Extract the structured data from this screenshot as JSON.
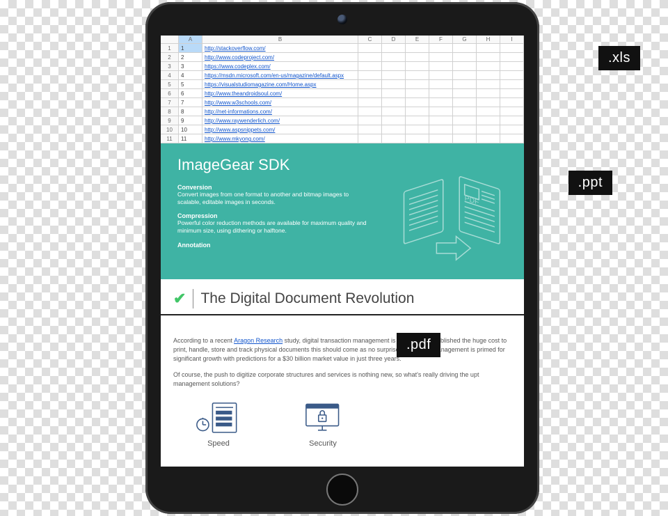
{
  "badges": {
    "xls": ".xls",
    "ppt": ".ppt",
    "pdf": ".pdf"
  },
  "spreadsheet": {
    "columns": [
      "A",
      "B",
      "C",
      "D",
      "E",
      "F",
      "G",
      "H",
      "I"
    ],
    "rows": [
      {
        "n": "1",
        "a": "1",
        "url": "http://stackoverflow.com/"
      },
      {
        "n": "2",
        "a": "2",
        "url": "http://www.codeproject.com/"
      },
      {
        "n": "3",
        "a": "3",
        "url": "https://www.codeplex.com/"
      },
      {
        "n": "4",
        "a": "4",
        "url": "https://msdn.microsoft.com/en-us/magazine/default.aspx"
      },
      {
        "n": "5",
        "a": "5",
        "url": "https://visualstudiomagazine.com/Home.aspx"
      },
      {
        "n": "6",
        "a": "6",
        "url": "http://www.theandroidsoul.com/"
      },
      {
        "n": "7",
        "a": "7",
        "url": "http://www.w3schools.com/"
      },
      {
        "n": "8",
        "a": "8",
        "url": "http://net-informations.com/"
      },
      {
        "n": "9",
        "a": "9",
        "url": "http://www.raywenderlich.com/"
      },
      {
        "n": "10",
        "a": "10",
        "url": "http://www.aspsnippets.com/"
      },
      {
        "n": "11",
        "a": "11",
        "url": "http://www.mkyong.com/"
      }
    ]
  },
  "sdk": {
    "title": "ImageGear SDK",
    "blocks": [
      {
        "title": "Conversion",
        "desc": "Convert images from one format to another and bitmap images to scalable, editable images in seconds."
      },
      {
        "title": "Compression",
        "desc": "Powerful color reduction methods are available for maximum quality and minimum size, using dithering or halftone."
      },
      {
        "title": "Annotation",
        "desc": ""
      }
    ],
    "art_label": "PDF"
  },
  "doc": {
    "checkmark": "✔",
    "title": "The Digital Document Revolution",
    "p1a": "According to a recent ",
    "p1link": "Aragon Research",
    "p1b": " study, digital transaction management is now a well-established the huge cost to print, handle, store and track physical documents this should come as no surprise. Moreover, management is primed for significant growth with predictions for a $30 billion market value in just three years.",
    "p2": "Of course, the push to digitize corporate structures and services is nothing new, so what's really driving the upt management solutions?",
    "features": [
      {
        "name": "speed",
        "label": "Speed"
      },
      {
        "name": "security",
        "label": "Security"
      }
    ]
  }
}
